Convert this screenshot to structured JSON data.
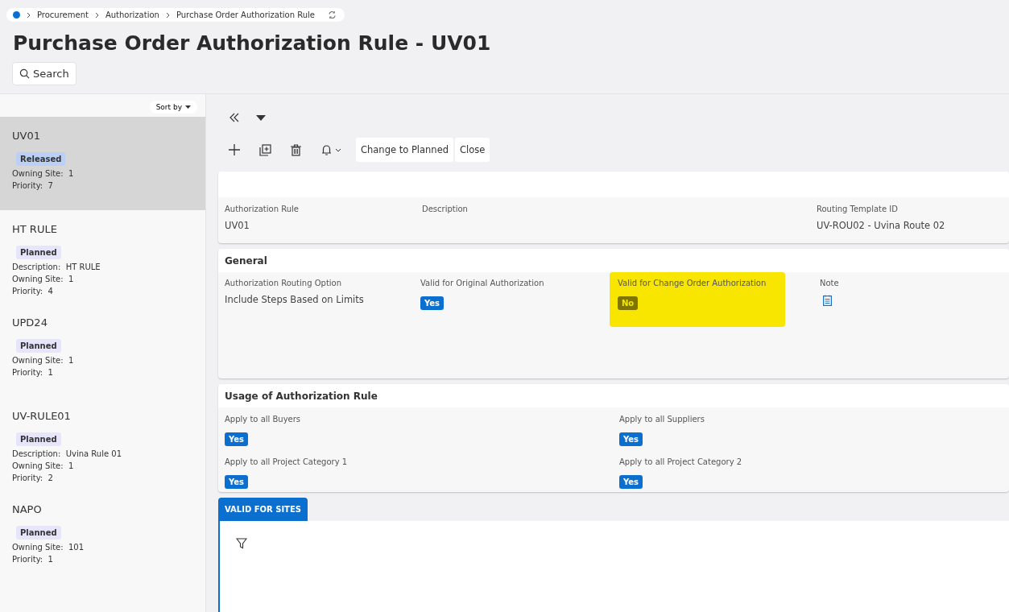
{
  "breadcrumb": [
    "Procurement",
    "Authorization",
    "Purchase Order Authorization Rule"
  ],
  "title": "Purchase Order Authorization Rule - UV01",
  "search_button": "Search",
  "sidebar": {
    "sort_label": "Sort by",
    "items": [
      {
        "name": "UV01",
        "status": "Released",
        "selected": true,
        "fields": [
          {
            "label": "Owning Site:",
            "value": "1"
          },
          {
            "label": "Priority:",
            "value": "7"
          }
        ]
      },
      {
        "name": "HT RULE",
        "status": "Planned",
        "selected": false,
        "fields": [
          {
            "label": "Description:",
            "value": "HT RULE"
          },
          {
            "label": "Owning Site:",
            "value": "1"
          },
          {
            "label": "Priority:",
            "value": "4"
          }
        ]
      },
      {
        "name": "UPD24",
        "status": "Planned",
        "selected": false,
        "fields": [
          {
            "label": "Owning Site:",
            "value": "1"
          },
          {
            "label": "Priority:",
            "value": "1"
          }
        ]
      },
      {
        "name": "UV-RULE01",
        "status": "Planned",
        "selected": false,
        "fields": [
          {
            "label": "Description:",
            "value": "Uvina Rule 01"
          },
          {
            "label": "Owning Site:",
            "value": "1"
          },
          {
            "label": "Priority:",
            "value": "2"
          }
        ]
      },
      {
        "name": "NAPO",
        "status": "Planned",
        "selected": false,
        "fields": [
          {
            "label": "Owning Site:",
            "value": "101"
          },
          {
            "label": "Priority:",
            "value": "1"
          }
        ]
      }
    ]
  },
  "toolbar": {
    "buttons": [
      "Change to Planned",
      "Close"
    ]
  },
  "header_fields": [
    {
      "label": "Authorization Rule",
      "value": "UV01"
    },
    {
      "label": "Description"
    },
    {
      "label": "Routing Template ID",
      "value": "UV-ROU02 -  Uvina Route 02"
    }
  ],
  "general": {
    "title": "General",
    "fields": [
      {
        "kind": "text",
        "label": "Authorization Routing Option",
        "value": "Include Steps Based on Limits",
        "highlighted": false
      },
      {
        "kind": "toggle",
        "label": "Valid for Original Authorization",
        "value": "Yes",
        "on": true,
        "highlighted": false
      },
      {
        "kind": "toggle",
        "label": "Valid for Change Order Authorization",
        "value": "No",
        "on": false,
        "highlighted": true
      },
      {
        "kind": "note",
        "label": "Note",
        "highlighted": false
      }
    ]
  },
  "usage": {
    "title": "Usage of Authorization Rule",
    "fields": [
      {
        "label": "Apply to all Buyers",
        "value": "Yes",
        "on": true
      },
      {
        "label": "Apply to all Suppliers",
        "value": "Yes",
        "on": true
      },
      {
        "label": "Apply to all Project Category 1",
        "value": "Yes",
        "on": true
      },
      {
        "label": "Apply to all Project Category 2",
        "value": "Yes",
        "on": true
      }
    ]
  },
  "tabs": [
    {
      "label": "VALID FOR SITES",
      "selected": true
    }
  ]
}
